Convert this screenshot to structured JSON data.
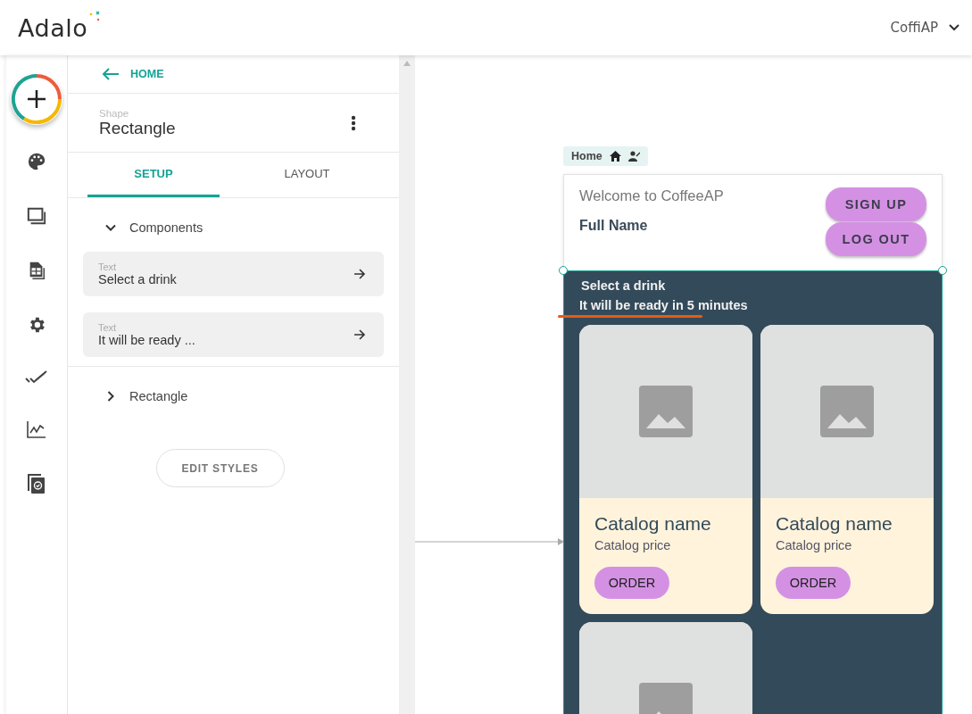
{
  "header": {
    "logo": "Adalo",
    "app_name": "CoffiAP"
  },
  "panel": {
    "back": "HOME",
    "type_label": "Shape",
    "title": "Rectangle",
    "tabs": [
      {
        "label": "SETUP",
        "selected": true
      },
      {
        "label": "LAYOUT",
        "selected": false
      }
    ],
    "sections": [
      {
        "label": "Components",
        "expanded": true,
        "items": [
          {
            "label": "Text",
            "value": "Select a drink"
          },
          {
            "label": "Text",
            "value": "It will be ready ..."
          }
        ]
      },
      {
        "label": "Rectangle",
        "expanded": false
      }
    ],
    "edit_button": "EDIT STYLES"
  },
  "canvas": {
    "screen_label": "Home",
    "header": {
      "welcome": "Welcome to CoffeeAP",
      "name": "Full Name",
      "buttons": [
        "SIGN UP",
        "LOG OUT"
      ]
    },
    "rect": {
      "title": "Select a drink",
      "subtitle": "It will be ready in 5 minutes"
    },
    "cards": [
      {
        "kind": "product",
        "name": "Catalog name",
        "price": "Catalog price",
        "button": "ORDER"
      },
      {
        "kind": "product",
        "name": "Catalog name",
        "price": "Catalog price",
        "button": "ORDER"
      },
      {
        "kind": "image"
      }
    ]
  }
}
